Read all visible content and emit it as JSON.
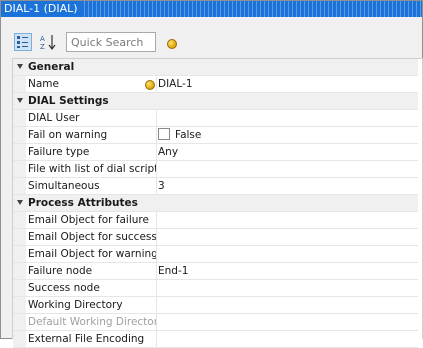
{
  "window": {
    "title": "DIAL-1 (DIAL)"
  },
  "toolbar": {
    "categorized_icon": "categorized-view-icon",
    "alphabetical_icon": "alphabetical-sort-icon",
    "search_placeholder": "Quick Search",
    "help_icon": "property-pages-icon"
  },
  "colors": {
    "titlebar": "#1b73d9",
    "category_bg": "#f0f0f0",
    "disabled_text": "#a0a0a0"
  },
  "sections": [
    {
      "title": "General",
      "rows": [
        {
          "label": "Name",
          "value": "DIAL-1",
          "icon": "name-coin-icon"
        }
      ]
    },
    {
      "title": "DIAL Settings",
      "rows": [
        {
          "label": "DIAL User",
          "value": ""
        },
        {
          "label": "Fail on warning",
          "value": "False",
          "checkbox": false
        },
        {
          "label": "Failure type",
          "value": "Any"
        },
        {
          "label": "File with list of dial scripts",
          "value": ""
        },
        {
          "label": "Simultaneous",
          "value": "3"
        }
      ]
    },
    {
      "title": "Process Attributes",
      "rows": [
        {
          "label": "Email Object for failure",
          "value": ""
        },
        {
          "label": "Email Object for success",
          "value": ""
        },
        {
          "label": "Email Object for warning",
          "value": ""
        },
        {
          "label": "Failure node",
          "value": "End-1"
        },
        {
          "label": "Success node",
          "value": ""
        },
        {
          "label": "Working Directory",
          "value": ""
        },
        {
          "label": "Default Working Directory",
          "value": "",
          "disabled": true
        },
        {
          "label": "External File Encoding",
          "value": ""
        }
      ]
    }
  ]
}
